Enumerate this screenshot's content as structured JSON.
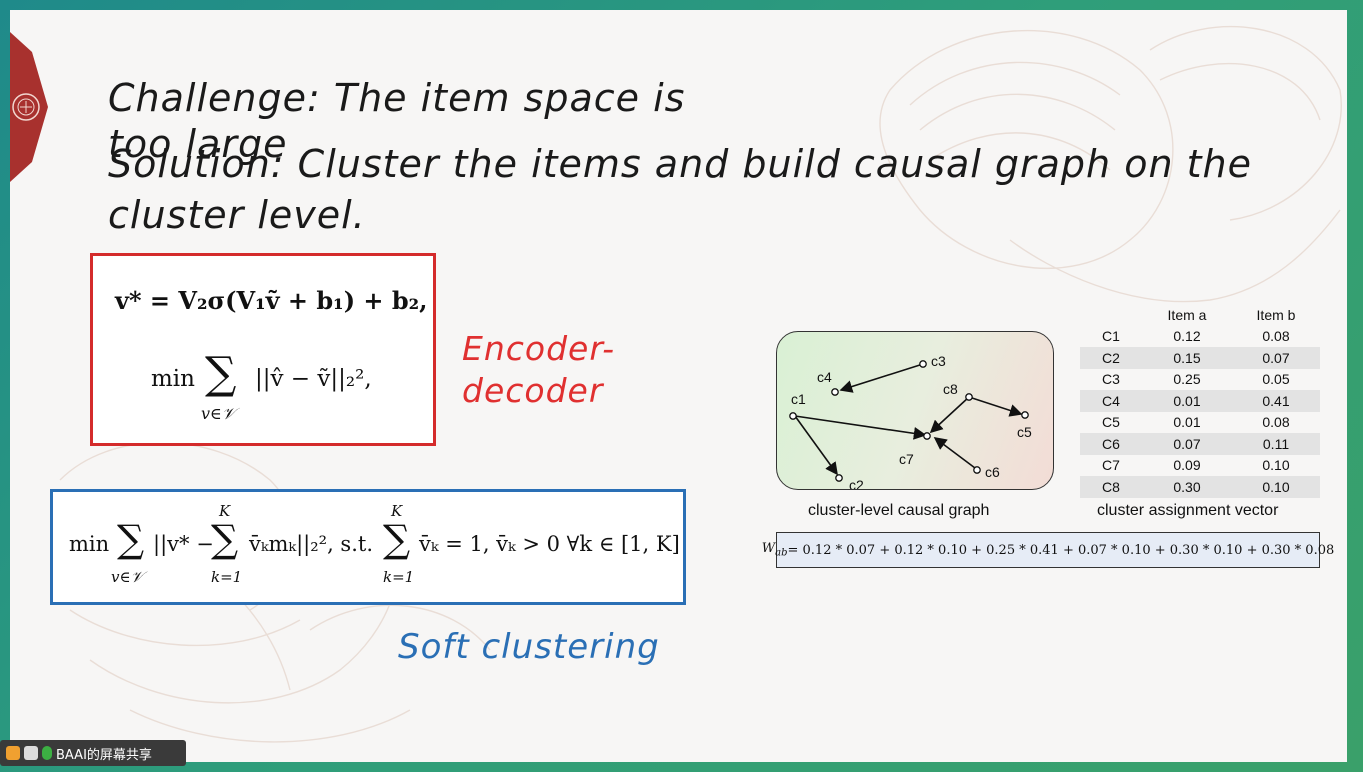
{
  "slide": {
    "title_line1": "Challenge: The item space is",
    "title_line1b": "too large",
    "title_line2": "Solution: Cluster the items and build causal graph on the",
    "title_line3": "cluster level.",
    "label_encoder": [
      "Encoder-",
      "decoder"
    ],
    "label_soft": "Soft clustering",
    "equation1": "v* = V₂σ(V₁ṽ + b₁) + b₂,",
    "equation2_min": "min",
    "equation2_expr": "||v̂ − ṽ||₂²,",
    "equation2_sub": "v∈𝒱",
    "equation3_expr": "||v* − ",
    "equation3_rest": "v̄ₖmₖ||₂²,  s.t. ",
    "equation3_cond": "v̄ₖ = 1,  v̄ₖ > 0 ∀k ∈ [1, K]",
    "sum_upper": "K",
    "sum_lower": "k=1"
  },
  "graph": {
    "caption": "cluster-level causal graph",
    "nodes": [
      "c1",
      "c2",
      "c3",
      "c4",
      "c5",
      "c6",
      "c7",
      "c8"
    ]
  },
  "table": {
    "caption": "cluster assignment vector",
    "headers": [
      "",
      "Item a",
      "Item b"
    ],
    "rows": [
      [
        "C1",
        "0.12",
        "0.08"
      ],
      [
        "C2",
        "0.15",
        "0.07"
      ],
      [
        "C3",
        "0.25",
        "0.05"
      ],
      [
        "C4",
        "0.01",
        "0.41"
      ],
      [
        "C5",
        "0.01",
        "0.08"
      ],
      [
        "C6",
        "0.07",
        "0.11"
      ],
      [
        "C7",
        "0.09",
        "0.10"
      ],
      [
        "C8",
        "0.30",
        "0.10"
      ]
    ]
  },
  "formula": {
    "lhs": "W",
    "lhs_sub": "ab",
    "rhs": " = 0.12 * 0.07 + 0.12 * 0.10 + 0.25 * 0.41 + 0.07 * 0.10 + 0.30 * 0.10 + 0.30 * 0.08"
  },
  "taskbar": {
    "label": "BAAI的屏幕共享"
  },
  "colors": {
    "encoder_red": "#d42b2b",
    "soft_blue": "#2a6fb5"
  }
}
